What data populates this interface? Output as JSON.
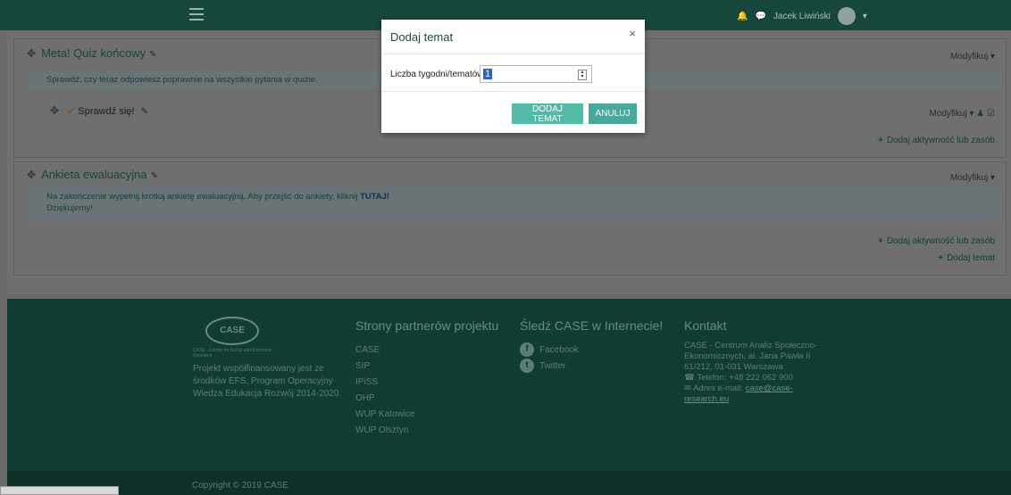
{
  "topbar": {
    "user_name": "Jacek Liwiński"
  },
  "sections": [
    {
      "title": "Meta! Quiz końcowy",
      "modify_label": "Modyfikuj",
      "summary": "Sprawdź, czy teraz odpowiesz poprawnie na wszystkie pytania w quizie.",
      "activity": {
        "name": "Sprawdź się!",
        "modify_label": "Modyfikuj"
      },
      "add_activity": "Dodaj aktywność lub zasób"
    },
    {
      "title": "Ankieta ewaluacyjna",
      "modify_label": "Modyfikuj",
      "summary_line1": "Na zakończenie wypełnij krótką ankietę ewaluacyjną. Aby przejść do ankiety, kliknij",
      "summary_link": "TUTAJ!",
      "summary_line2": "Dziękujemy!",
      "add_activity": "Dodaj aktywność lub zasób",
      "add_topic": "Dodaj temat"
    }
  ],
  "modal": {
    "title": "Dodaj temat",
    "close": "×",
    "field_label": "Liczba tygodni/tematów",
    "field_value": "1",
    "confirm_label": "DODAJ TEMAT",
    "cancel_label": "ANULUJ"
  },
  "footer": {
    "logo_text": "CASE",
    "logo_subtitle": "CASE - Center for Social and Economic Research",
    "project_text": "Projekt współfinansowany jest ze środków EFS, Program Operacyjny Wiedza Edukacja Rozwój 2014-2020",
    "partners_heading": "Strony partnerów projektu",
    "partners": [
      "CASE",
      "SIP",
      "IPiSS",
      "OHP",
      "WUP Katowice",
      "WUP Olsztyn"
    ],
    "social_heading": "Śledź CASE w Internecie!",
    "social": [
      {
        "icon": "facebook-icon",
        "label": "Facebook"
      },
      {
        "icon": "twitter-icon",
        "label": "Twitter"
      }
    ],
    "contact_heading": "Kontakt",
    "contact_address": "CASE - Centrum Analiz Społeczno-Ekonomicznych, al. Jana Pawła II 61/212, 01-031 Warszawa",
    "contact_phone": "Telefon: +48 222 062 900",
    "contact_email_label": "Adres e-mail:",
    "contact_email": "case@case-research.eu",
    "copyright": "Copyright © 2019 CASE"
  },
  "colors": {
    "header": "#17463c",
    "footer": "#113c33",
    "accent": "#55b9a7"
  }
}
